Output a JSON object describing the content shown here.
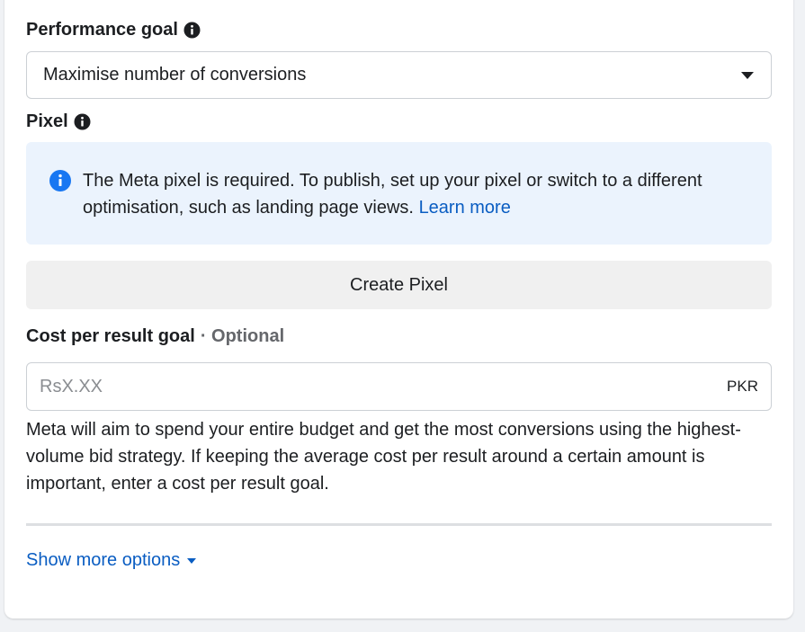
{
  "performance_goal": {
    "label": "Performance goal",
    "selected": "Maximise number of conversions"
  },
  "pixel": {
    "label": "Pixel",
    "notice_text": "The Meta pixel is required. To publish, set up your pixel or switch to a different optimisation, such as landing page views.",
    "learn_more": "Learn more",
    "create_button": "Create Pixel"
  },
  "cost_goal": {
    "label": "Cost per result goal",
    "optional": "· Optional",
    "placeholder": "RsX.XX",
    "value": "",
    "currency": "PKR",
    "helper": "Meta will aim to spend your entire budget and get the most conversions using the highest-volume bid strategy. If keeping the average cost per result around a certain amount is important, enter a cost per result goal."
  },
  "show_more": "Show more options",
  "colors": {
    "accent": "#0a5dc2",
    "info_icon": "#1877f2",
    "notice_bg": "#ebf3fd"
  },
  "icons": {
    "info": "info-circle-icon",
    "caret": "caret-down-icon"
  }
}
